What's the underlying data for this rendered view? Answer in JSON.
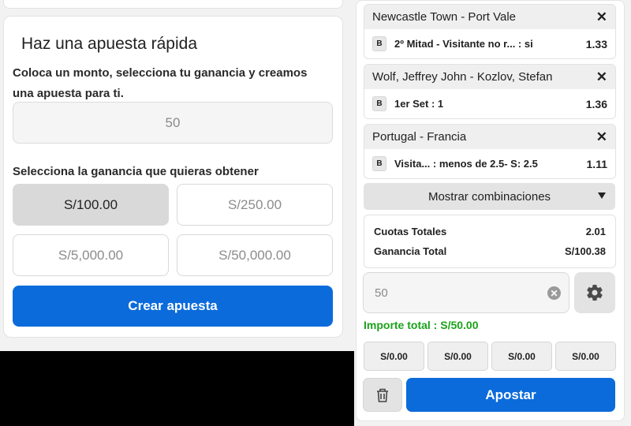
{
  "quick_bet": {
    "title": "Haz una apuesta rápida",
    "description": "Coloca un monto, selecciona tu ganancia y creamos una apuesta para ti.",
    "amount_value": "50",
    "select_label": "Selecciona la ganancia que quieras obtener",
    "gain_options": [
      "S/100.00",
      "S/250.00",
      "S/5,000.00",
      "S/50,000.00"
    ],
    "selected_gain": "S/100.00",
    "create_button": "Crear apuesta"
  },
  "betslip": {
    "bets": [
      {
        "event": "Newcastle Town - Port Vale",
        "badge": "B",
        "selection": "2º Mitad - Visitante no r...  : si",
        "odd": "1.33"
      },
      {
        "event": "Wolf, Jeffrey John - Kozlov, Stefan",
        "badge": "B",
        "selection": "1er Set : 1",
        "odd": "1.36"
      },
      {
        "event": "Portugal - Francia",
        "badge": "B",
        "selection": "Visita... : menos de 2.5- S: 2.5",
        "odd": "1.11"
      }
    ],
    "close_symbol": "✕",
    "show_combinations": "Mostrar combinaciones",
    "total_odds_label": "Cuotas Totales",
    "total_odds_value": "2.01",
    "total_gain_label": "Ganancia Total",
    "total_gain_value": "S/100.38",
    "stake_value": "50",
    "importe_label": "Importe total :",
    "importe_value": "S/50.00",
    "quick_stakes": [
      "S/0.00",
      "S/0.00",
      "S/0.00",
      "S/0.00"
    ],
    "bet_button": "Apostar"
  },
  "colors": {
    "primary_blue": "#0b6bdb",
    "success_green": "#1aa31a",
    "selected_gray": "#d9d9d9"
  },
  "icons": [
    "close-icon",
    "chevron-down-icon",
    "clear-icon",
    "gear-icon",
    "trash-icon"
  ]
}
